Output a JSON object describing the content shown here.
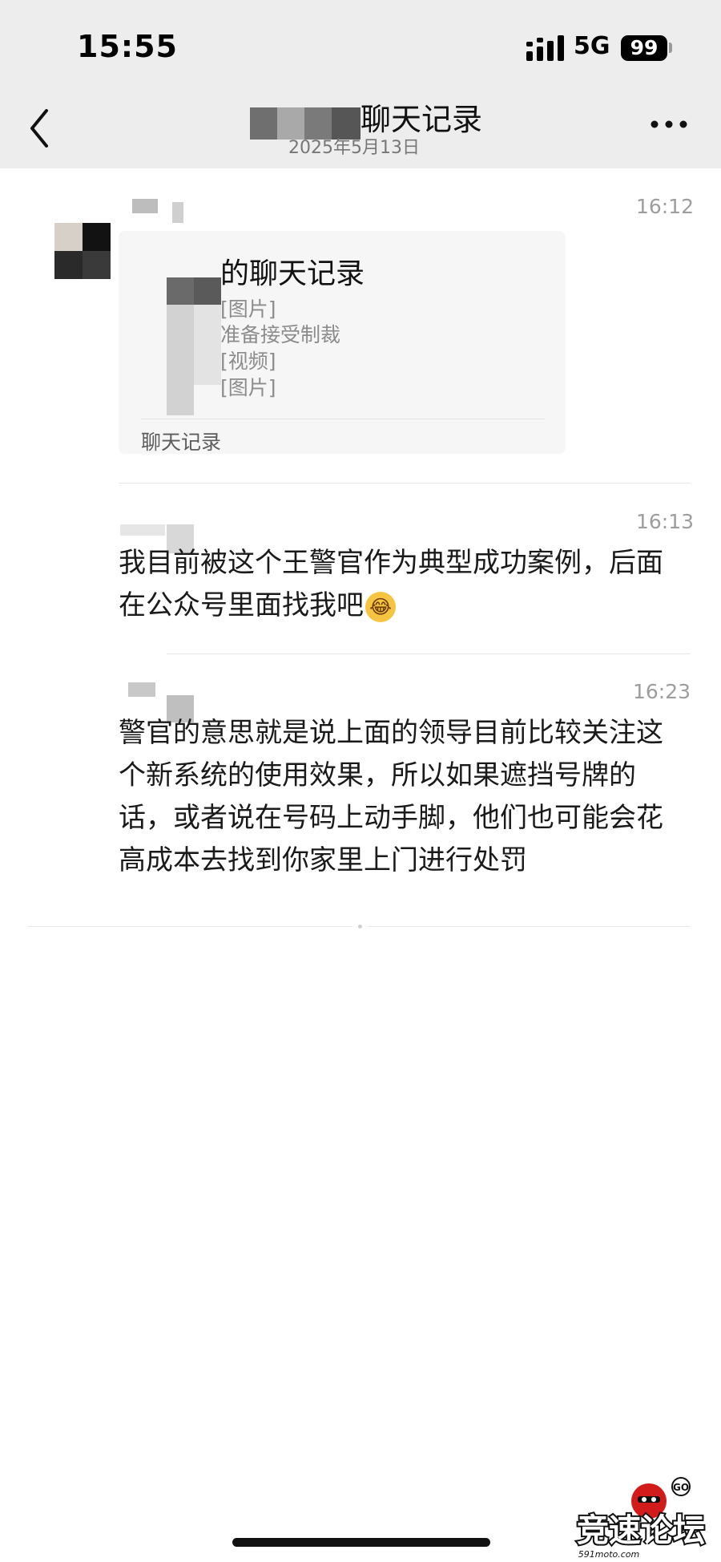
{
  "status_bar": {
    "time": "15:55",
    "network": "5G",
    "battery": "99"
  },
  "nav": {
    "title": "聊天记录",
    "subtitle": "2025年5月13日"
  },
  "messages": [
    {
      "time": "16:12",
      "type": "chat-record-card",
      "card_title": "的聊天记录",
      "card_lines": [
        "[图片]",
        "准备接受制裁",
        "[视频]",
        "[图片]"
      ],
      "card_footer": "聊天记录"
    },
    {
      "time": "16:13",
      "type": "text",
      "text": "我目前被这个王警官作为典型成功案例，后面在公众号里面找我吧"
    },
    {
      "time": "16:23",
      "type": "text",
      "text": "警官的意思就是说上面的领导目前比较关注这个新系统的使用效果，所以如果遮挡号牌的话，或者说在号码上动手脚，他们也可能会花高成本去找到你家里上门进行处罚"
    }
  ],
  "watermark": {
    "brand": "竞速论坛",
    "site": "591moto.com",
    "badge": "GO"
  },
  "colors": {
    "header_bg": "#ededed",
    "card_bg": "#f6f6f6",
    "timestamp": "#9d9d9d"
  }
}
